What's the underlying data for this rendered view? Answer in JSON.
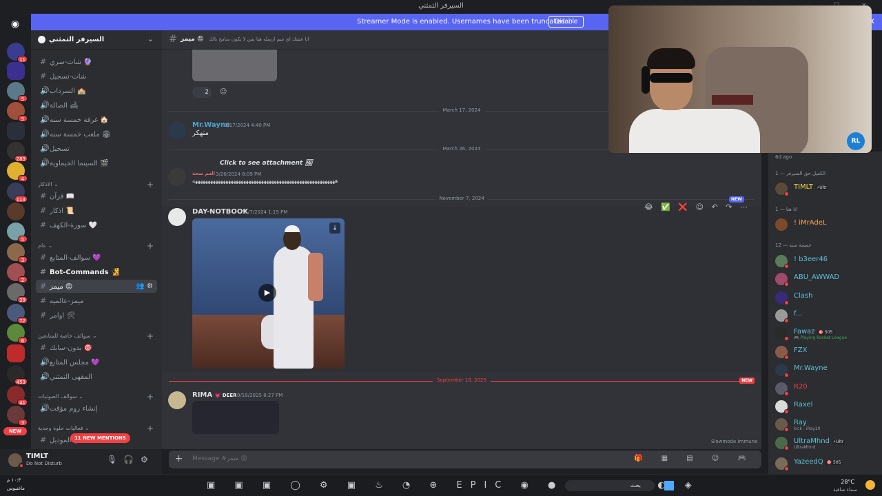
{
  "window": {
    "title": "السيرفر التمثني",
    "controls": "— ☐ ✕"
  },
  "banner": {
    "text": "Streamer Mode is enabled. Usernames have been truncated.",
    "disable_label": "Disable",
    "close": "✕"
  },
  "guilds": {
    "badges": [
      "11",
      "5",
      "5",
      "283",
      "4",
      "113",
      "5",
      "3",
      "2",
      "29",
      "72",
      "6",
      "453",
      "41",
      "3"
    ],
    "new_label": "NEW"
  },
  "server": {
    "name": "السيرفر التمثني",
    "chevron": "⌄"
  },
  "channels": {
    "items": [
      {
        "name": "شات-سري 🔮",
        "glyph": "#"
      },
      {
        "name": "شات-تسجيل",
        "glyph": "#"
      },
      {
        "name": "السرداب 🏫",
        "glyph": "🔊"
      },
      {
        "name": "الصالة 🛋",
        "glyph": "🔊"
      },
      {
        "name": "غرفة خمسة سنه 🏠",
        "glyph": "🔊"
      },
      {
        "name": "ملعب خمسة سنه 🏟",
        "glyph": "🔊"
      },
      {
        "name": "تسجيل",
        "glyph": "🔊"
      },
      {
        "name": "السينما الحيماوية 🎬",
        "glyph": "🔊"
      },
      {
        "name": "قرآن 📖",
        "glyph": "#"
      },
      {
        "name": "اذكار 📜",
        "glyph": "#"
      },
      {
        "name": "سورة-الكهف 🤍",
        "glyph": "#"
      },
      {
        "name": "سوالف-المتابع 💜",
        "glyph": "#"
      },
      {
        "name": "Bot-Commands 🧏",
        "glyph": "#"
      },
      {
        "name": "ميمز 😡",
        "glyph": "#"
      },
      {
        "name": "ميمز-عالميه",
        "glyph": "#"
      },
      {
        "name": "اوامر 🛠",
        "glyph": "#"
      },
      {
        "name": "بدون-سابك 🎯",
        "glyph": "#"
      },
      {
        "name": "مجلس المتابع 💜",
        "glyph": "🔊"
      },
      {
        "name": "المقهى التمثني",
        "glyph": "🔊"
      },
      {
        "name": "إنشاء روم مؤقت",
        "glyph": "🔊"
      },
      {
        "name": "حقل-الموديل",
        "glyph": "#"
      }
    ],
    "categories": [
      "الاذكار",
      "عام",
      "سوالف خاصة للمتابعين",
      "سوالف الصوتيات",
      "فعاليات حلوة وجدية"
    ],
    "active_tools": "👥 ⚙",
    "mentions_label": "11 NEW MENTIONS"
  },
  "user": {
    "name": "TIMLT",
    "status": "Do Not Disturb",
    "icons": {
      "mic": "🎙",
      "headset": "🎧",
      "settings": "⚙"
    }
  },
  "chat": {
    "channel_name": "ميمز 😡",
    "topic": "انا عتبتك اي ميم ارسله هنا بس لا يكون سامح بالك",
    "reaction_count": "2",
    "dates": [
      "March 17, 2024",
      "March 26, 2024",
      "November 7, 2024",
      "September 18, 2025"
    ],
    "new_label": "NEW",
    "messages": [
      {
        "author": "Mr.Wayne",
        "time": "3/17/2024 4:40 PM",
        "text": "متهكر",
        "color": "#4fa3d1"
      },
      {
        "author": "العم صحة",
        "time": "3/26/2024 8:09 PM",
        "reply": "Click to see attachment",
        "text": "ههههههههههههههههههههههههههههههههههههههههههههههههههههههههه",
        "color": "#e06c6c"
      },
      {
        "author": "DAY-NOTBOOK",
        "time": "11/7/2024 1:15 PM",
        "color": "#dbdee1"
      },
      {
        "author": "RIMA",
        "badge": "💗 DEER",
        "time": "9/18/2025 8:27 PM",
        "color": "#dbdee1"
      }
    ],
    "hover_actions": "😂 ✅ ❌ ☺ ↶ ↷ ⋯",
    "slowmode": "Slowmode Immune",
    "composer_placeholder": "Message #ميمز 😡"
  },
  "members": {
    "top_note": "6d ago",
    "categories": [
      "الكفيل حق السيرفر — 1",
      "انا هنا — 1",
      "خمسة سنه — 12"
    ],
    "items": [
      {
        "name": "TIMLT",
        "tag": "⚡Ultr",
        "color": "#f5d34a"
      },
      {
        "name": "! iMrAdeL",
        "color": "#f5a05a"
      },
      {
        "name": "! b3eer46",
        "color": "#5ec2d6"
      },
      {
        "name": "ABU_AWWAD",
        "color": "#5ec2d6"
      },
      {
        "name": "Clash",
        "color": "#5ec2d6"
      },
      {
        "name": "f...",
        "color": "#5ec2d6"
      },
      {
        "name": "Fawaz",
        "tag": "🎯 505",
        "sub": "🎮 Playing Rocket League",
        "color": "#5ec2d6"
      },
      {
        "name": "FZX",
        "color": "#5ec2d6"
      },
      {
        "name": "Mr.Wayne",
        "color": "#5ec2d6"
      },
      {
        "name": "R20",
        "color": "#f23f43"
      },
      {
        "name": "Raxel",
        "color": "#5ec2d6"
      },
      {
        "name": "Ray",
        "sub": "kick : iRay10",
        "color": "#5ec2d6"
      },
      {
        "name": "UltraMhnd",
        "tag": "⚡Ultr",
        "sub": "UltraMhnd",
        "color": "#5ec2d6"
      },
      {
        "name": "YazeedQ",
        "tag": "🎯 505",
        "color": "#5ec2d6"
      }
    ]
  },
  "taskbar": {
    "left_top": "١٠:٣ م",
    "left_bottom": "ماغنبوس",
    "apps": "▣ ▣ ▣ ◯ ⚙ ▣ ♨ ◔ ⊕ EPIC ◉ ● ✉ ▦ ▤ ◐ ◈",
    "search": "بحث",
    "weather_temp": "28°C",
    "weather_desc": "سماء صافية"
  },
  "colors": {
    "blurple": "#5865f2",
    "red": "#f23f43",
    "bg": "#313338",
    "sidebar": "#2b2d31"
  }
}
